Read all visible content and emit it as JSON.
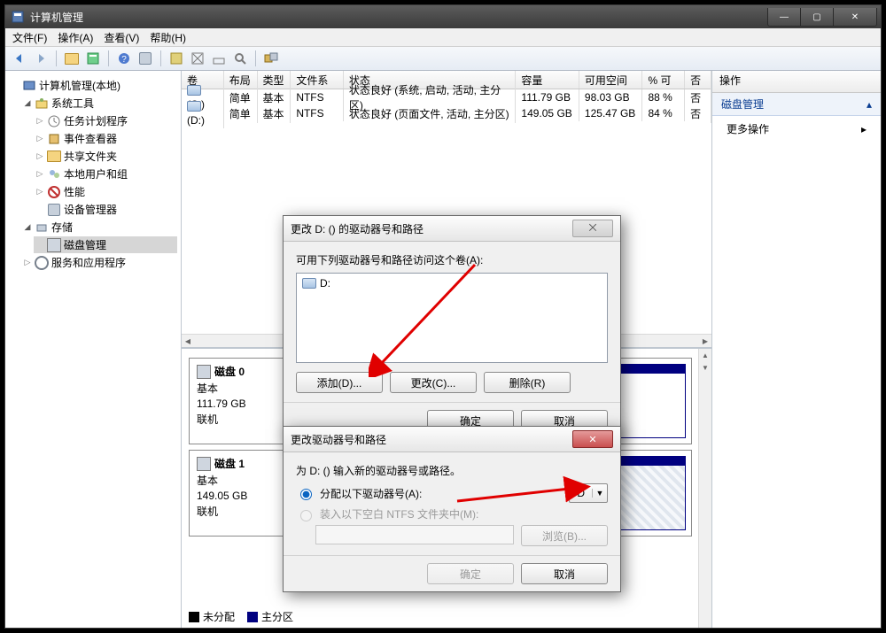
{
  "window": {
    "title": "计算机管理"
  },
  "menu": {
    "file": "文件(F)",
    "action": "操作(A)",
    "view": "查看(V)",
    "help": "帮助(H)"
  },
  "tree": {
    "root": "计算机管理(本地)",
    "system_tools": "系统工具",
    "task_sched": "任务计划程序",
    "event_viewer": "事件查看器",
    "shared": "共享文件夹",
    "users": "本地用户和组",
    "perf": "性能",
    "devmgr": "设备管理器",
    "storage": "存储",
    "disk_mgmt": "磁盘管理",
    "services": "服务和应用程序"
  },
  "vol_table": {
    "hdr": {
      "vol": "卷",
      "layout": "布局",
      "type": "类型",
      "fs": "文件系统",
      "status": "状态",
      "cap": "容量",
      "free": "可用空间",
      "pct": "% 可用",
      "last": "否"
    },
    "rows": [
      {
        "vol": "(C:)",
        "layout": "简单",
        "type": "基本",
        "fs": "NTFS",
        "status": "状态良好 (系统, 启动, 活动, 主分区)",
        "cap": "111.79 GB",
        "free": "98.03 GB",
        "pct": "88 %",
        "last": "否"
      },
      {
        "vol": "(D:)",
        "layout": "简单",
        "type": "基本",
        "fs": "NTFS",
        "status": "状态良好 (页面文件, 活动, 主分区)",
        "cap": "149.05 GB",
        "free": "125.47 GB",
        "pct": "84 %",
        "last": "否"
      }
    ]
  },
  "disks": [
    {
      "name": "磁盘 0",
      "kind": "基本",
      "size": "111.79 GB",
      "state": "联机"
    },
    {
      "name": "磁盘 1",
      "kind": "基本",
      "size": "149.05 GB",
      "state": "联机"
    }
  ],
  "legend": {
    "unalloc": "未分配",
    "primary": "主分区"
  },
  "right": {
    "header": "操作",
    "group": "磁盘管理",
    "more": "更多操作"
  },
  "dlg1": {
    "title": "更改 D: () 的驱动器号和路径",
    "prompt": "可用下列驱动器号和路径访问这个卷(A):",
    "entry": "D:",
    "add": "添加(D)...",
    "change": "更改(C)...",
    "remove": "删除(R)",
    "ok": "确定",
    "cancel": "取消"
  },
  "dlg2": {
    "title": "更改驱动器号和路径",
    "prompt": "为 D: () 输入新的驱动器号或路径。",
    "assign_label": "分配以下驱动器号(A):",
    "mount_label": "装入以下空白 NTFS 文件夹中(M):",
    "drive_sel": "D",
    "browse": "浏览(B)...",
    "ok": "确定",
    "cancel": "取消"
  }
}
